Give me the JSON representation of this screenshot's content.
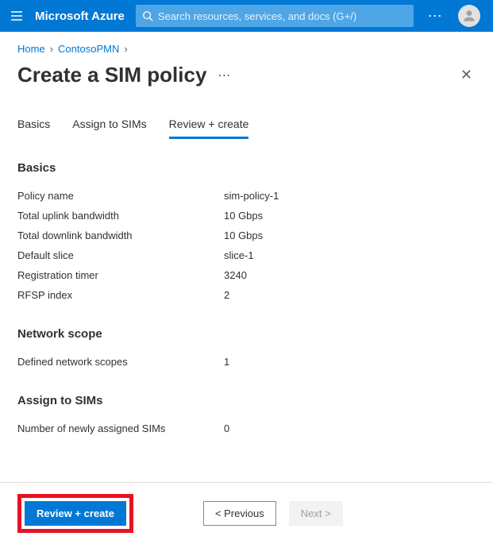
{
  "header": {
    "brand": "Microsoft Azure",
    "search_placeholder": "Search resources, services, and docs (G+/)"
  },
  "breadcrumb": {
    "items": [
      "Home",
      "ContosoPMN"
    ]
  },
  "page": {
    "title": "Create a SIM policy"
  },
  "tabs": {
    "items": [
      {
        "label": "Basics"
      },
      {
        "label": "Assign to SIMs"
      },
      {
        "label": "Review + create"
      }
    ],
    "active_index": 2
  },
  "sections": {
    "basics": {
      "heading": "Basics",
      "rows": [
        {
          "k": "Policy name",
          "v": "sim-policy-1"
        },
        {
          "k": "Total uplink bandwidth",
          "v": "10 Gbps"
        },
        {
          "k": "Total downlink bandwidth",
          "v": "10 Gbps"
        },
        {
          "k": "Default slice",
          "v": "slice-1"
        },
        {
          "k": "Registration timer",
          "v": "3240"
        },
        {
          "k": "RFSP index",
          "v": "2"
        }
      ]
    },
    "network": {
      "heading": "Network scope",
      "rows": [
        {
          "k": "Defined network scopes",
          "v": "1"
        }
      ]
    },
    "assign": {
      "heading": "Assign to SIMs",
      "rows": [
        {
          "k": "Number of newly assigned SIMs",
          "v": "0"
        }
      ]
    }
  },
  "footer": {
    "primary": "Review + create",
    "previous": "<  Previous",
    "next": "Next  >"
  }
}
